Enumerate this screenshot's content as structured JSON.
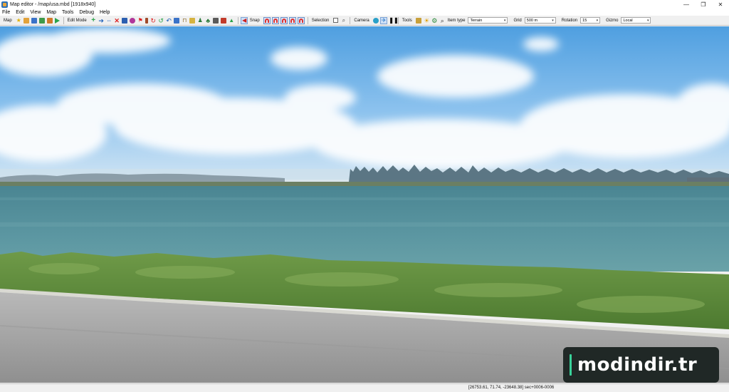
{
  "window": {
    "title": "Map editor - /map/usa.mbd [1918x940]",
    "minimize": "—",
    "maximize": "❐",
    "close": "✕"
  },
  "menu": [
    "File",
    "Edit",
    "View",
    "Map",
    "Tools",
    "Debug",
    "Help"
  ],
  "toolbar": {
    "map_label": "Map",
    "edit_mode_label": "Edit Mode",
    "snap_label": "Snap",
    "selection_label": "Selection",
    "camera_label": "Camera",
    "tools_label": "Tools",
    "item_type_label": "Item type",
    "item_type_value": "Terrain",
    "grid_label": "Grid",
    "grid_value": "500 m",
    "rotation_label": "Rotation",
    "rotation_value": "15",
    "gizmo_label": "Gizmo",
    "gizmo_value": "Local"
  },
  "status": {
    "coords": "[26753.61, 71.74, -23648.38] sec+0006-0006"
  },
  "watermark": {
    "text": "modindir.tr"
  },
  "colors": {
    "accent": "#39d29a",
    "sky_top": "#4f9fe0",
    "water": "#4f8e9a",
    "grass": "#5b8a3a",
    "road": "#a3a3a3"
  }
}
